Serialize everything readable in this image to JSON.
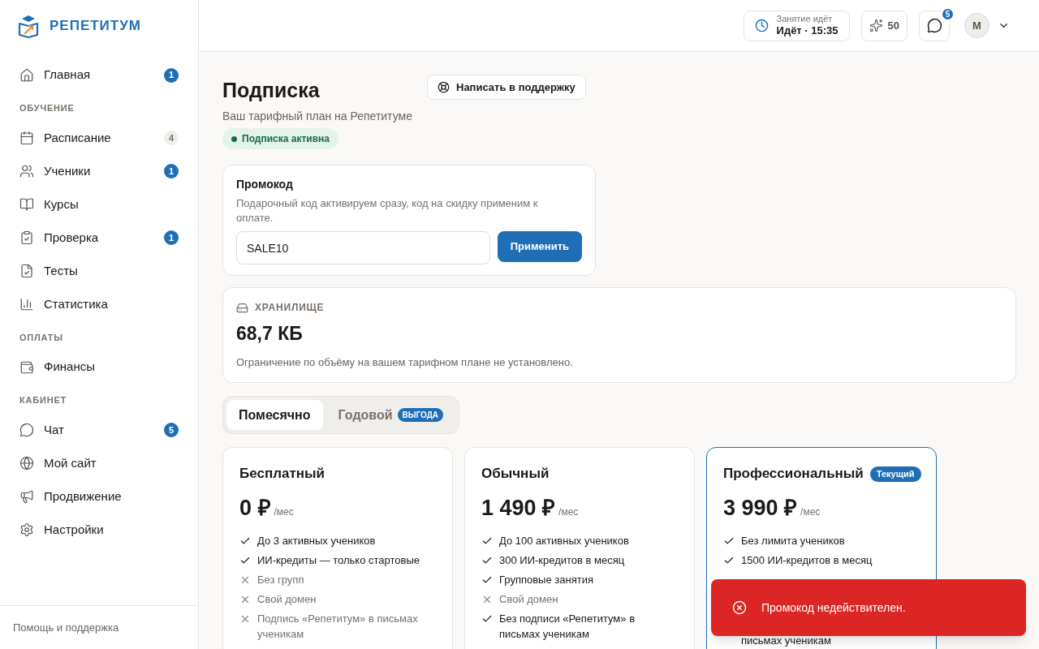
{
  "sidebar": {
    "logo_text": "РЕПЕТИТУМ",
    "sections": [
      {
        "items": [
          {
            "label": "Главная",
            "badge": "1",
            "highlighted": true,
            "selected": false
          }
        ]
      },
      {
        "heading": "ОБУЧЕНИЕ",
        "items": [
          {
            "label": "Расписание",
            "badge": "4",
            "highlighted": false,
            "selected": false
          },
          {
            "label": "Ученики",
            "badge": "1",
            "highlighted": true,
            "selected": false
          },
          {
            "label": "Курсы",
            "selected": false
          },
          {
            "label": "Проверка",
            "badge": "1",
            "highlighted": true,
            "selected": false
          },
          {
            "label": "Тесты",
            "selected": false
          },
          {
            "label": "Статистика",
            "selected": false
          }
        ]
      },
      {
        "heading": "ОПЛАТЫ",
        "items": [
          {
            "label": "Финансы",
            "selected": false
          }
        ]
      },
      {
        "heading": "КАБИНЕТ",
        "items": [
          {
            "label": "Чат",
            "badge": "5",
            "highlighted": true,
            "selected": false
          },
          {
            "label": "Мой сайт",
            "selected": false
          },
          {
            "label": "Продвижение",
            "selected": false
          },
          {
            "label": "Настройки",
            "selected": false
          }
        ]
      }
    ],
    "footer_link": "Помощь и поддержка"
  },
  "header": {
    "lesson": {
      "caption": "Занятие идёт",
      "status": "Идёт · 15:35"
    },
    "credits": "50",
    "chat_badge": "5",
    "avatar": "М"
  },
  "page": {
    "title": "Подписка",
    "subtitle": "Ваш тарифный план на Репетитуме",
    "support_button": "Написать в поддержку",
    "status_badge": "Подписка активна"
  },
  "promo": {
    "title": "Промокод",
    "description": "Подарочный код активируем сразу, код на скидку применим к оплате.",
    "value": "SALE10",
    "button": "Применить"
  },
  "storage": {
    "label": "ХРАНИЛИЩЕ",
    "amount": "68,7 КБ",
    "note": "Ограничение по объёму на вашем тарифном плане не установлено."
  },
  "billing_tabs": [
    {
      "label": "Помесячно",
      "selected": true
    },
    {
      "label": "Годовой",
      "badge": "ВЫГОДА",
      "selected": false
    }
  ],
  "plans": [
    {
      "name": "Бесплатный",
      "price": "0 ₽",
      "period": "/мес",
      "current": false,
      "features": [
        {
          "text": "До 3 активных учеников",
          "included": true
        },
        {
          "text": "ИИ-кредиты — только стартовые",
          "included": true
        },
        {
          "text": "Без групп",
          "included": false
        },
        {
          "text": "Свой домен",
          "included": false
        },
        {
          "text": "Подпись «Репетитум» в письмах ученикам",
          "included": false
        }
      ]
    },
    {
      "name": "Обычный",
      "price": "1 490 ₽",
      "period": "/мес",
      "current": false,
      "features": [
        {
          "text": "До 100 активных учеников",
          "included": true
        },
        {
          "text": "300 ИИ-кредитов в месяц",
          "included": true
        },
        {
          "text": "Групповые занятия",
          "included": true
        },
        {
          "text": "Свой домен",
          "included": false
        },
        {
          "text": "Без подписи «Репетитум» в письмах ученикам",
          "included": true
        }
      ]
    },
    {
      "name": "Профессиональный",
      "price": "3 990 ₽",
      "period": "/мес",
      "current": true,
      "current_label": "Текущий",
      "features": [
        {
          "text": "Без лимита учеников",
          "included": true
        },
        {
          "text": "1500 ИИ-кредитов в месяц",
          "included": true
        },
        {
          "text": "письмах ученикам",
          "kind": "continuation"
        }
      ]
    }
  ],
  "toast": {
    "kind": "error",
    "message": "Промокод недействителен."
  }
}
